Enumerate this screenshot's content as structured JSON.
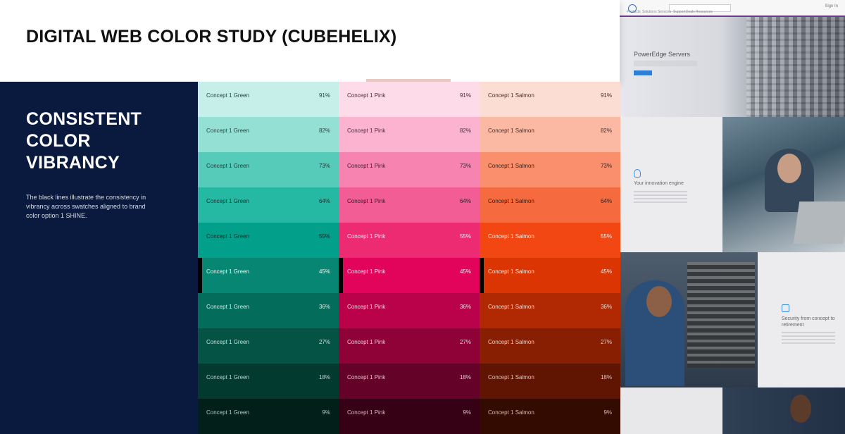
{
  "header": {
    "title": "DIGITAL WEB COLOR STUDY (CUBEHELIX)"
  },
  "side": {
    "heading_lines": [
      "CONSISTENT",
      "COLOR",
      "VIBRANCY"
    ],
    "description": "The black lines illustrate the consistency in vibrancy across swatches aligned to brand color option 1 SHINE."
  },
  "columns": [
    {
      "label": "Concept 1 Green",
      "swatches": [
        {
          "pct": "91%",
          "bg": "#c5efe8",
          "fg": "#25443f"
        },
        {
          "pct": "82%",
          "bg": "#95e0d4",
          "fg": "#25443f"
        },
        {
          "pct": "73%",
          "bg": "#57cbb9",
          "fg": "#1c3a35"
        },
        {
          "pct": "64%",
          "bg": "#25b8a2",
          "fg": "#123530"
        },
        {
          "pct": "55%",
          "bg": "#02a08b",
          "fg": "#0e2c27"
        },
        {
          "pct": "45%",
          "bg": "#078773",
          "fg": "#e9f5f2",
          "marker": true
        },
        {
          "pct": "36%",
          "bg": "#036c5b",
          "fg": "#d4ebe6"
        },
        {
          "pct": "27%",
          "bg": "#045345",
          "fg": "#c7e1dc"
        },
        {
          "pct": "18%",
          "bg": "#023a30",
          "fg": "#bdd6d1"
        },
        {
          "pct": "9%",
          "bg": "#021f1a",
          "fg": "#b3cbc6"
        }
      ]
    },
    {
      "label": "Concept 1 Pink",
      "swatches": [
        {
          "pct": "91%",
          "bg": "#fddbe8",
          "fg": "#4b2a36"
        },
        {
          "pct": "82%",
          "bg": "#fbb3cf",
          "fg": "#4b2a36"
        },
        {
          "pct": "73%",
          "bg": "#f784b0",
          "fg": "#40202c"
        },
        {
          "pct": "64%",
          "bg": "#f25d95",
          "fg": "#3a1826"
        },
        {
          "pct": "55%",
          "bg": "#ec2b73",
          "fg": "#fbe3ec"
        },
        {
          "pct": "45%",
          "bg": "#e2045b",
          "fg": "#fde7ef",
          "marker": true
        },
        {
          "pct": "36%",
          "bg": "#b9024a",
          "fg": "#f6d8e3"
        },
        {
          "pct": "27%",
          "bg": "#8f0238",
          "fg": "#f0ccd9"
        },
        {
          "pct": "18%",
          "bg": "#640227",
          "fg": "#e8c2d0"
        },
        {
          "pct": "9%",
          "bg": "#360114",
          "fg": "#dcb8c5"
        }
      ]
    },
    {
      "label": "Concept 1 Salmon",
      "swatches": [
        {
          "pct": "91%",
          "bg": "#fcddd4",
          "fg": "#4a2d25"
        },
        {
          "pct": "82%",
          "bg": "#fbb9a3",
          "fg": "#4a2d25"
        },
        {
          "pct": "73%",
          "bg": "#f98f6d",
          "fg": "#3e2118"
        },
        {
          "pct": "64%",
          "bg": "#f66a3f",
          "fg": "#3a1a10"
        },
        {
          "pct": "55%",
          "bg": "#f24713",
          "fg": "#fde6de"
        },
        {
          "pct": "45%",
          "bg": "#da3502",
          "fg": "#fde8e0",
          "marker": true
        },
        {
          "pct": "36%",
          "bg": "#b12902",
          "fg": "#f6d9cf"
        },
        {
          "pct": "27%",
          "bg": "#881f02",
          "fg": "#efcdc2"
        },
        {
          "pct": "18%",
          "bg": "#5f1502",
          "fg": "#e6c3b8"
        },
        {
          "pct": "9%",
          "bg": "#330b01",
          "fg": "#dab9ae"
        }
      ]
    }
  ],
  "site": {
    "hero_title": "PowerEdge Servers",
    "tile1_title": "Your innovation engine",
    "tile4_title": "Security from concept to retirement",
    "nav": [
      "Products",
      "Solutions",
      "Services",
      "Support",
      "Deals",
      "Resources"
    ],
    "account": "Sign In"
  }
}
